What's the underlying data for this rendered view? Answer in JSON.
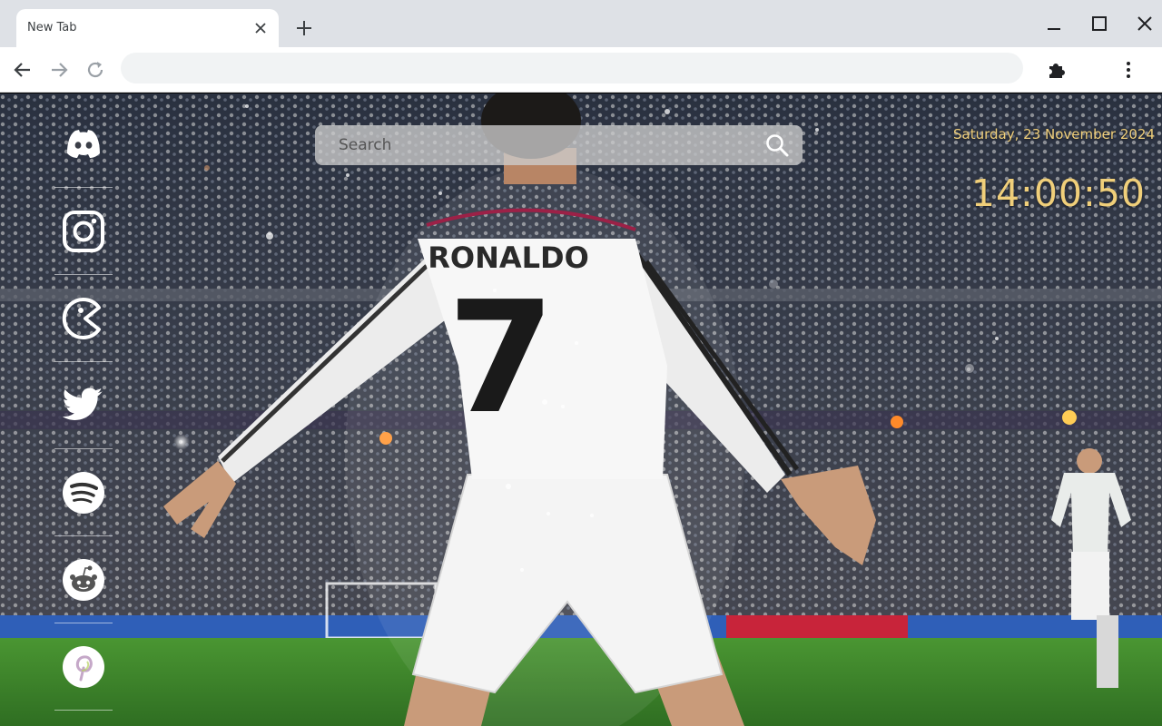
{
  "browser": {
    "tab_title": "New Tab",
    "omnibox_value": ""
  },
  "icons": {
    "tab_close": "close-icon",
    "new_tab": "plus-icon",
    "minimize": "minimize-icon",
    "maximize": "maximize-icon",
    "close_window": "close-icon",
    "back": "arrow-left-icon",
    "forward": "arrow-right-icon",
    "reload": "reload-icon",
    "extensions": "puzzle-icon",
    "menu": "kebab-menu-icon"
  },
  "sidebar": {
    "links": [
      "discord",
      "instagram",
      "pacman",
      "twitter",
      "spotify",
      "reddit",
      "pinterest"
    ]
  },
  "search": {
    "placeholder": "Search",
    "value": ""
  },
  "datetime": {
    "date": "Saturday, 23 November 2024",
    "time": "14:00:50"
  },
  "wallpaper": {
    "jersey_name": "RONALDO",
    "jersey_number": "7"
  },
  "colors": {
    "clock": "#f0cf7a",
    "tabstrip": "#dee1e6",
    "pitch": "#3f8a2c"
  }
}
